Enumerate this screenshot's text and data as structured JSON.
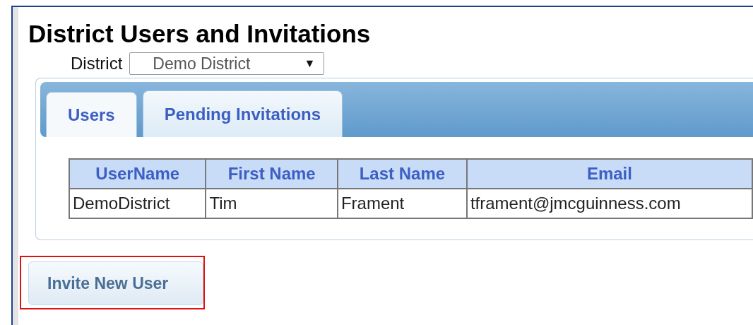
{
  "page": {
    "title": "District Users and Invitations"
  },
  "district": {
    "label": "District",
    "value": "Demo District",
    "arrow": "▼"
  },
  "tabs": [
    {
      "label": "Users",
      "selected": true
    },
    {
      "label": "Pending Invitations",
      "selected": false
    }
  ],
  "table": {
    "columns": [
      "UserName",
      "First Name",
      "Last Name",
      "Email"
    ],
    "rows": [
      [
        "DemoDistrict",
        "Tim",
        "Frament",
        "tframent@jmcguinness.com"
      ]
    ]
  },
  "invite_button": {
    "label": "Invite New User",
    "highlighted": true
  }
}
